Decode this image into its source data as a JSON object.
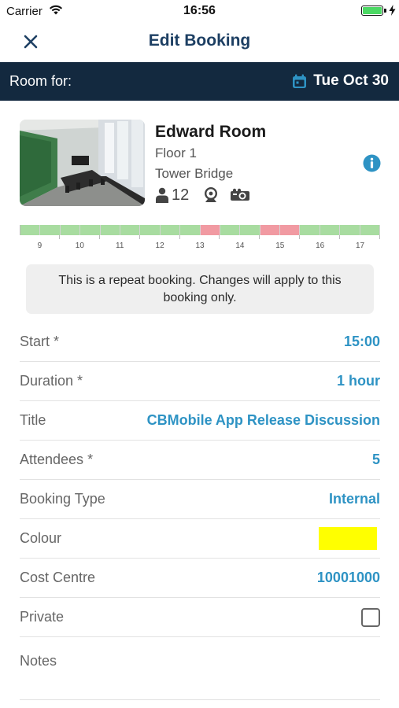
{
  "status_bar": {
    "carrier": "Carrier",
    "time": "16:56",
    "battery_level": 1.0
  },
  "nav": {
    "title": "Edit Booking",
    "close_icon": "close-icon",
    "color": "#1d3f63"
  },
  "room_bar": {
    "label": "Room for:",
    "date": "Tue Oct 30",
    "calendar_icon": "calendar-icon",
    "background": "#13293f",
    "icon_color": "#2e93c4"
  },
  "room": {
    "name": "Edward Room",
    "floor": "Floor 1",
    "building": "Tower Bridge",
    "capacity": "12",
    "feature_icons": [
      "person-icon",
      "webcam-icon",
      "projector-icon"
    ],
    "info_icon": "info-icon"
  },
  "timeline": {
    "hours": [
      "9",
      "10",
      "11",
      "12",
      "13",
      "14",
      "15",
      "16",
      "17"
    ],
    "slots": [
      "free",
      "free",
      "free",
      "free",
      "free",
      "free",
      "free",
      "free",
      "free",
      "busy",
      "free",
      "free",
      "busy",
      "busy",
      "free",
      "free",
      "free",
      "free"
    ],
    "free_color": "#a8dca0",
    "busy_color": "#f19aa2"
  },
  "notice": "This is a repeat booking. Changes will apply to this booking only.",
  "form": {
    "start_label": "Start *",
    "start_value": "15:00",
    "duration_label": "Duration *",
    "duration_value": "1 hour",
    "title_label": "Title",
    "title_value": "CBMobile App Release Discussion",
    "attendees_label": "Attendees *",
    "attendees_value": "5",
    "booking_type_label": "Booking Type",
    "booking_type_value": "Internal",
    "colour_label": "Colour",
    "colour_value": "#ffff00",
    "cost_centre_label": "Cost Centre",
    "cost_centre_value": "10001000",
    "private_label": "Private",
    "private_checked": false,
    "notes_placeholder": "Notes",
    "value_color": "#2e93c4"
  }
}
